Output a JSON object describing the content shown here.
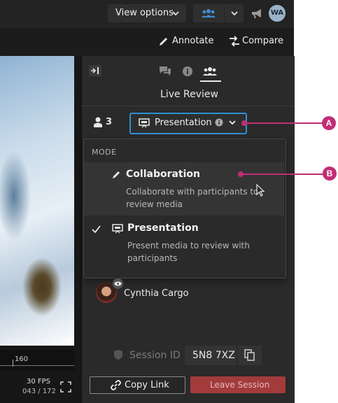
{
  "topbar": {
    "view_options_label": "View options",
    "avatar_initials": "WA"
  },
  "toolbar": {
    "annotate_label": "Annotate",
    "compare_label": "Compare"
  },
  "viewer": {
    "timeline_tick": "160",
    "fps": "30 FPS",
    "frame_counter": "043 / 172"
  },
  "panel": {
    "title": "Live Review",
    "participant_count": "3",
    "mode_select_value": "Presentation",
    "dropdown": {
      "header": "MODE",
      "options": [
        {
          "label": "Collaboration",
          "description": "Collaborate with participants to review media",
          "selected": false
        },
        {
          "label": "Presentation",
          "description": "Present media to review with participants",
          "selected": true
        }
      ]
    },
    "participant_name": "Cynthia Cargo",
    "session_id_label": "Session ID",
    "session_id_value": "5N8 7XZ",
    "copy_link_label": "Copy Link",
    "leave_session_label": "Leave Session"
  },
  "callouts": {
    "a": "A",
    "b": "B"
  },
  "colors": {
    "accent_blue": "#2f8fd0",
    "callout_magenta": "#c02e75",
    "leave_red": "#a33b3b"
  }
}
